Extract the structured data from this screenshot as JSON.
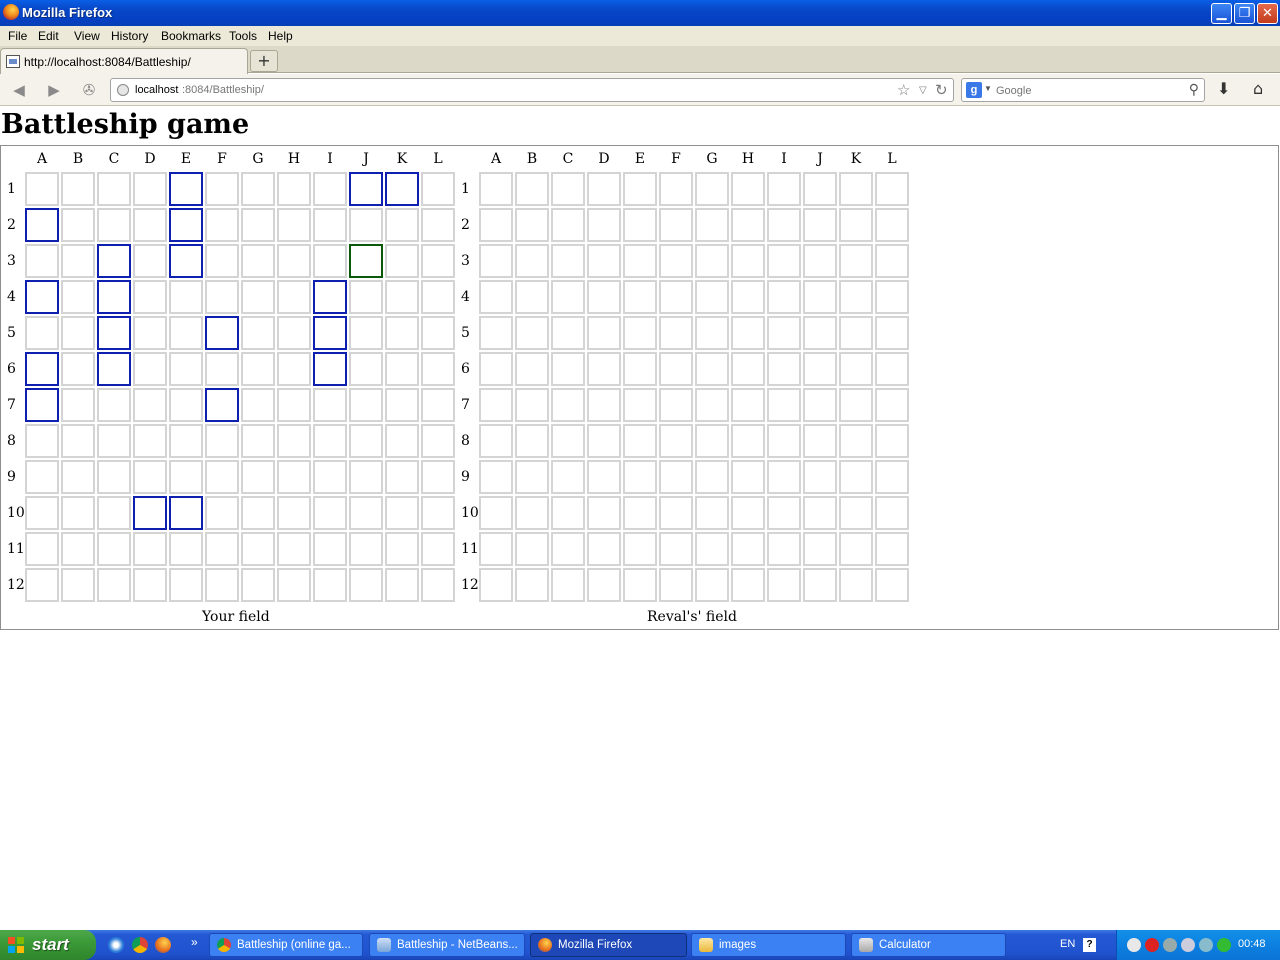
{
  "window": {
    "title": "Mozilla Firefox"
  },
  "menu": [
    "File",
    "Edit",
    "View",
    "History",
    "Bookmarks",
    "Tools",
    "Help"
  ],
  "tab": {
    "label": "http://localhost:8084/Battleship/",
    "new_tab": "+"
  },
  "url": {
    "host": "localhost",
    "path": ":8084/Battleship/"
  },
  "search": {
    "engine": "g",
    "placeholder": "Google"
  },
  "page": {
    "heading": "Battleship game"
  },
  "boards": {
    "columns": [
      "A",
      "B",
      "C",
      "D",
      "E",
      "F",
      "G",
      "H",
      "I",
      "J",
      "K",
      "L"
    ],
    "rows": [
      "1",
      "2",
      "3",
      "4",
      "5",
      "6",
      "7",
      "8",
      "9",
      "10",
      "11",
      "12"
    ],
    "your_field_caption": "Your field",
    "rival_field_caption": "Reval's' field",
    "your_ships": [
      "E1",
      "J1",
      "K1",
      "A2",
      "E2",
      "C3",
      "E3",
      "A4",
      "C4",
      "I4",
      "C5",
      "F5",
      "I5",
      "A6",
      "C6",
      "I6",
      "A7",
      "F7",
      "D10",
      "E10"
    ],
    "your_hits": [
      "J3"
    ],
    "rival_marks": []
  },
  "colors": {
    "ship_border": "#0f1fb0",
    "hit_border": "#0b5a0b",
    "empty_border": "#d4d4d4"
  },
  "taskbar": {
    "start_label": "start",
    "overflow": "»",
    "tasks": [
      {
        "label": "Battleship (online ga...",
        "icon": "chrome-icon",
        "active": false
      },
      {
        "label": "Battleship - NetBeans...",
        "icon": "netbeans-icon",
        "active": false
      },
      {
        "label": "Mozilla Firefox",
        "icon": "firefox-icon",
        "active": true
      },
      {
        "label": "images",
        "icon": "folder-icon",
        "active": false
      },
      {
        "label": "Calculator",
        "icon": "calculator-icon",
        "active": false
      }
    ],
    "language": "EN",
    "help": "?",
    "clock": "00:48"
  }
}
